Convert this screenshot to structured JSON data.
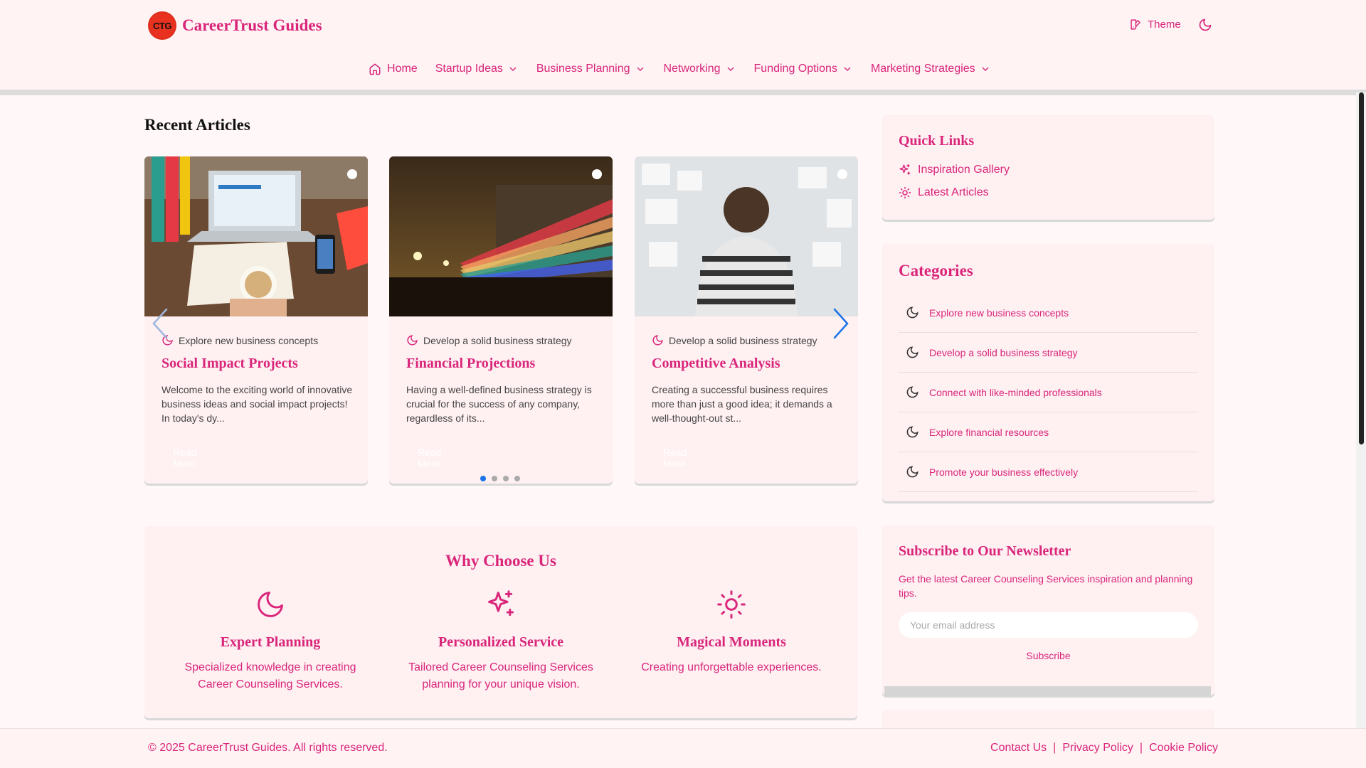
{
  "brand": {
    "logo_text": "CTG",
    "name": "CareerTrust Guides"
  },
  "header": {
    "theme_label": "Theme"
  },
  "nav": {
    "items": [
      {
        "label": "Home"
      },
      {
        "label": "Startup Ideas"
      },
      {
        "label": "Business Planning"
      },
      {
        "label": "Networking"
      },
      {
        "label": "Funding Options"
      },
      {
        "label": "Marketing Strategies"
      }
    ]
  },
  "main": {
    "recent_title": "Recent Articles",
    "articles": [
      {
        "category": "Explore new business concepts",
        "title": "Social Impact Projects",
        "excerpt": "Welcome to the exciting world of innovative business ideas and social impact projects! In today's dy...",
        "button": "Read More"
      },
      {
        "category": "Develop a solid business strategy",
        "title": "Financial Projections",
        "excerpt": "Having a well-defined business strategy is crucial for the success of any company, regardless of its...",
        "button": "Read More"
      },
      {
        "category": "Develop a solid business strategy",
        "title": "Competitive Analysis",
        "excerpt": "Creating a successful business requires more than just a good idea; it demands a well-thought-out st...",
        "button": "Read More"
      }
    ],
    "why": {
      "title": "Why Choose Us",
      "features": [
        {
          "title": "Expert Planning",
          "text": "Specialized knowledge in creating Career Counseling Services."
        },
        {
          "title": "Personalized Service",
          "text": "Tailored Career Counseling Services planning for your unique vision."
        },
        {
          "title": "Magical Moments",
          "text": "Creating unforgettable experiences."
        }
      ]
    }
  },
  "sidebar": {
    "quick_links": {
      "title": "Quick Links",
      "items": [
        {
          "label": "Inspiration Gallery"
        },
        {
          "label": "Latest Articles"
        }
      ]
    },
    "categories": {
      "title": "Categories",
      "items": [
        {
          "label": "Explore new business concepts"
        },
        {
          "label": "Develop a solid business strategy"
        },
        {
          "label": "Connect with like-minded professionals"
        },
        {
          "label": "Explore financial resources"
        },
        {
          "label": "Promote your business effectively"
        }
      ]
    },
    "newsletter": {
      "title": "Subscribe to Our Newsletter",
      "text": "Get the latest Career Counseling Services inspiration and planning tips.",
      "placeholder": "Your email address",
      "button": "Subscribe"
    }
  },
  "footer": {
    "copyright": "© 2025 CareerTrust Guides. All rights reserved.",
    "links": [
      {
        "label": "Contact Us"
      },
      {
        "label": "Privacy Policy"
      },
      {
        "label": "Cookie Policy"
      }
    ],
    "separator": "|"
  },
  "colors": {
    "accent": "#d9267a",
    "background": "#fff7f8",
    "card": "#fff0f2",
    "indicator_active": "#1a73e8"
  },
  "icons": {
    "theme": "palette-icon",
    "dark_mode": "moon-icon",
    "home": "home-icon",
    "dropdown": "chevron-down-icon",
    "category": "moon-icon",
    "quick_link_1": "sparkles-icon",
    "quick_link_2": "sun-icon",
    "feature_1": "moon-icon",
    "feature_2": "sparkles-icon",
    "feature_3": "sun-icon"
  }
}
